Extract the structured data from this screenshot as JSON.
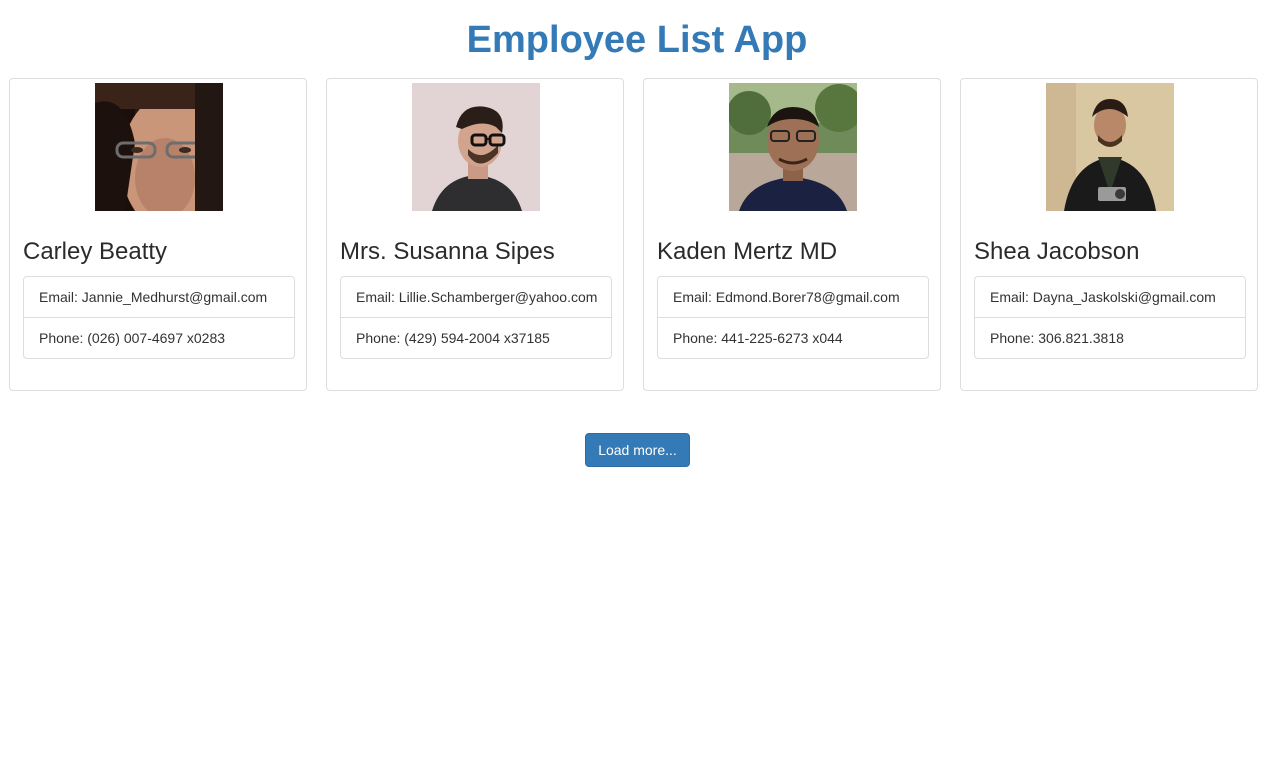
{
  "app": {
    "title": "Employee List App"
  },
  "employees": [
    {
      "name": "Carley Beatty",
      "email": "Email: Jannie_Medhurst@gmail.com",
      "phone": "Phone: (026) 007-4697 x0283"
    },
    {
      "name": "Mrs. Susanna Sipes",
      "email": "Email: Lillie.Schamberger@yahoo.com",
      "phone": "Phone: (429) 594-2004 x37185"
    },
    {
      "name": "Kaden Mertz MD",
      "email": "Email: Edmond.Borer78@gmail.com",
      "phone": "Phone: 441-225-6273 x044"
    },
    {
      "name": "Shea Jacobson",
      "email": "Email: Dayna_Jaskolski@gmail.com",
      "phone": "Phone: 306.821.3818"
    }
  ],
  "load_more": {
    "label": "Load more..."
  },
  "colors": {
    "accent": "#337ab7",
    "border": "#dddddd",
    "text": "#333333"
  }
}
